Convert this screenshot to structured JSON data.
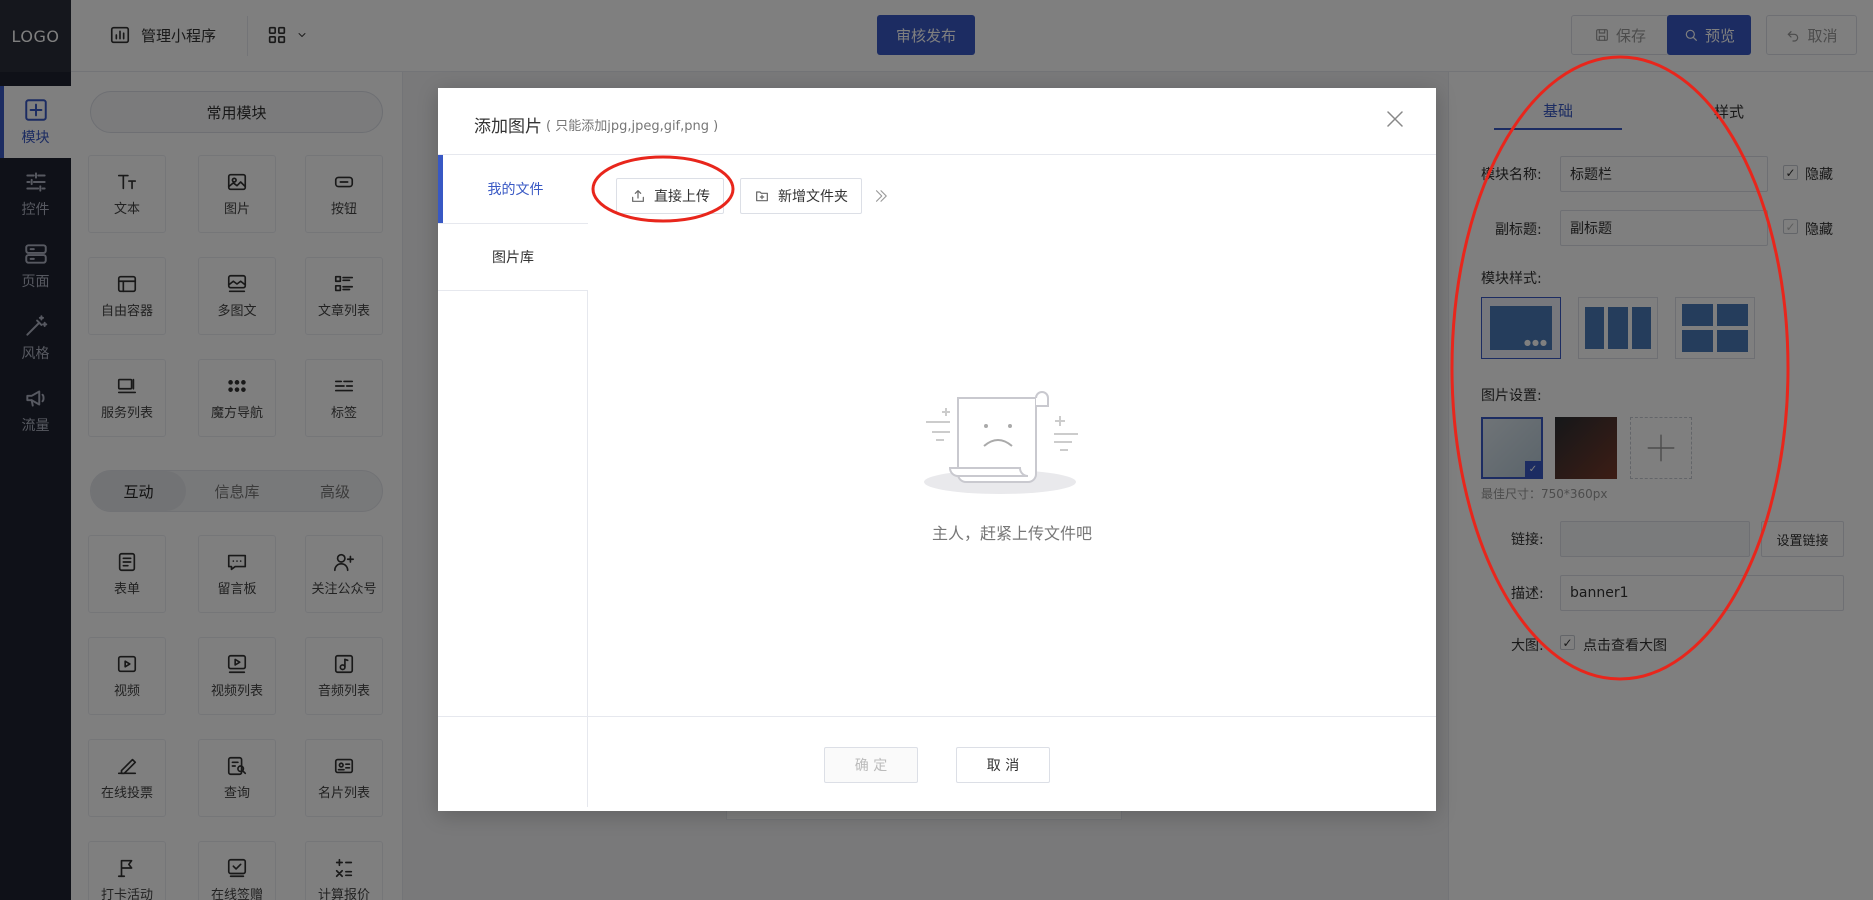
{
  "app": {
    "logo": "LOGO",
    "manage_label": "管理小程序",
    "publish_label": "审核发布",
    "save_label": "保存",
    "preview_label": "预览",
    "cancel_label": "取消"
  },
  "rail": [
    {
      "label": "模块",
      "icon": "plus-square-icon",
      "active": true
    },
    {
      "label": "控件",
      "icon": "sliders-icon"
    },
    {
      "label": "页面",
      "icon": "server-icon"
    },
    {
      "label": "风格",
      "icon": "magic-wand-icon"
    },
    {
      "label": "流量",
      "icon": "megaphone-icon"
    }
  ],
  "components": {
    "common_label": "常用模块",
    "common": [
      {
        "label": "文本",
        "icon": "text-icon"
      },
      {
        "label": "图片",
        "icon": "image-icon"
      },
      {
        "label": "按钮",
        "icon": "button-icon"
      },
      {
        "label": "自由容器",
        "icon": "container-icon"
      },
      {
        "label": "多图文",
        "icon": "multi-image-icon"
      },
      {
        "label": "文章列表",
        "icon": "article-list-icon"
      },
      {
        "label": "服务列表",
        "icon": "service-list-icon"
      },
      {
        "label": "魔方导航",
        "icon": "grid-dots-icon"
      },
      {
        "label": "标签",
        "icon": "tag-icon"
      }
    ],
    "segments": [
      "互动",
      "信息库",
      "高级"
    ],
    "interactive": [
      {
        "label": "表单",
        "icon": "form-icon"
      },
      {
        "label": "留言板",
        "icon": "message-board-icon"
      },
      {
        "label": "关注公众号",
        "icon": "follow-user-icon"
      },
      {
        "label": "视频",
        "icon": "video-icon"
      },
      {
        "label": "视频列表",
        "icon": "video-list-icon"
      },
      {
        "label": "音频列表",
        "icon": "audio-icon"
      },
      {
        "label": "在线投票",
        "icon": "vote-icon"
      },
      {
        "label": "查询",
        "icon": "query-icon"
      },
      {
        "label": "名片列表",
        "icon": "card-icon"
      },
      {
        "label": "打卡活动",
        "icon": "flag-icon"
      },
      {
        "label": "在线签赠",
        "icon": "sign-icon"
      },
      {
        "label": "计算报价",
        "icon": "calculator-icon"
      }
    ]
  },
  "settings": {
    "tabs": [
      "基础",
      "样式"
    ],
    "module_name_label": "模块名称:",
    "module_name_value": "标题栏",
    "subtitle_label": "副标题:",
    "subtitle_value": "副标题",
    "hide_label": "隐藏",
    "module_style_label": "模块样式:",
    "image_settings_label": "图片设置:",
    "best_size": "最佳尺寸：750*360px",
    "link_label": "链接:",
    "set_link_label": "设置链接",
    "desc_label": "描述:",
    "desc_value": "banner1",
    "bigimg_label": "大图:",
    "bigimg_option": "点击查看大图",
    "accent": "#3858c4",
    "annotation_color": "#e8261c"
  },
  "modal": {
    "title": "添加图片",
    "hint": "( 只能添加jpg,jpeg,gif,png )",
    "side_tabs": [
      "我的文件",
      "图片库"
    ],
    "upload_label": "直接上传",
    "new_folder_label": "新增文件夹",
    "empty_text": "主人，赶紧上传文件吧",
    "confirm_label": "确 定",
    "cancel_label": "取 消"
  }
}
